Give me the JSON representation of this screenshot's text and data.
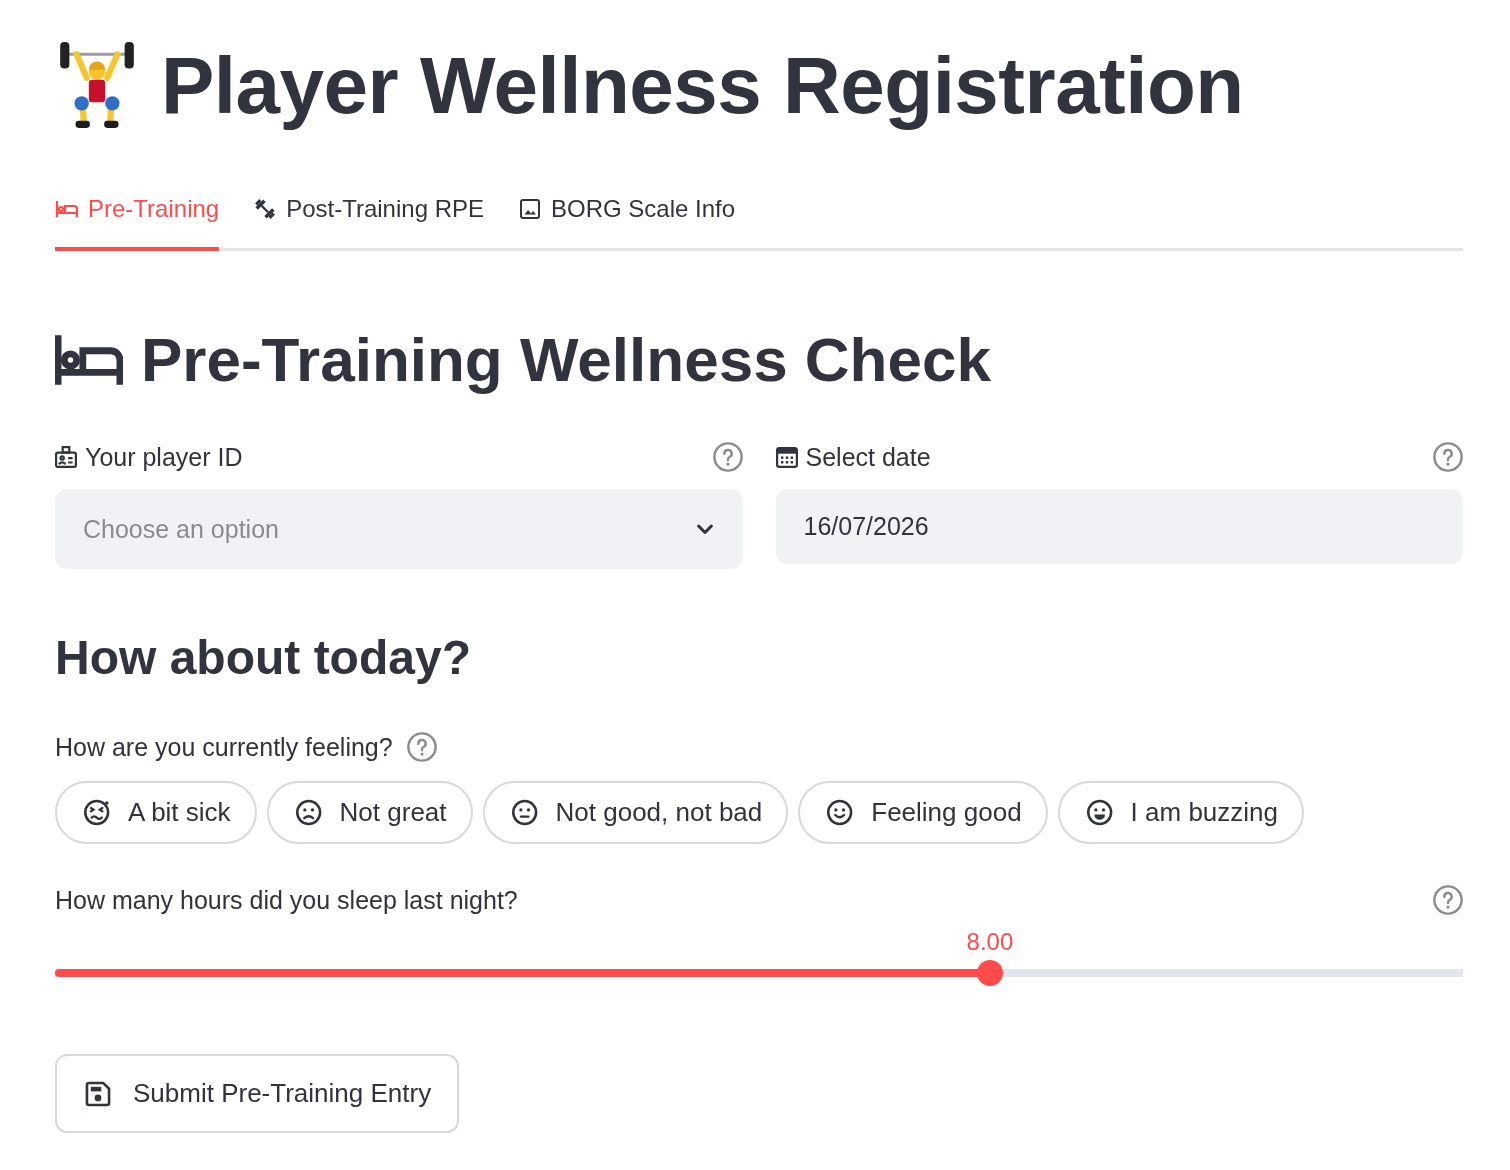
{
  "page": {
    "title": "Player Wellness Registration"
  },
  "tabs": [
    {
      "label": "Pre-Training",
      "selected": true
    },
    {
      "label": "Post-Training RPE",
      "selected": false
    },
    {
      "label": "BORG Scale Info",
      "selected": false
    }
  ],
  "section": {
    "title": "Pre-Training Wellness Check"
  },
  "fields": [
    {
      "kind": "select",
      "label": "Your player ID",
      "placeholder": "Choose an option"
    },
    {
      "kind": "date",
      "label": "Select date",
      "value": "16/07/2026"
    }
  ],
  "subheading": "How about today?",
  "feeling": {
    "label": "How are you currently feeling?",
    "options": [
      {
        "label": "A bit sick",
        "selected": false
      },
      {
        "label": "Not great",
        "selected": false
      },
      {
        "label": "Not good, not bad",
        "selected": false
      },
      {
        "label": "Feeling good",
        "selected": false
      },
      {
        "label": "I am buzzing",
        "selected": false
      }
    ]
  },
  "sleep": {
    "label": "How many hours did you sleep last night?",
    "reading": "8.00",
    "level": 0.664
  },
  "submit_button": {
    "label": "Submit Pre-Training Entry"
  }
}
